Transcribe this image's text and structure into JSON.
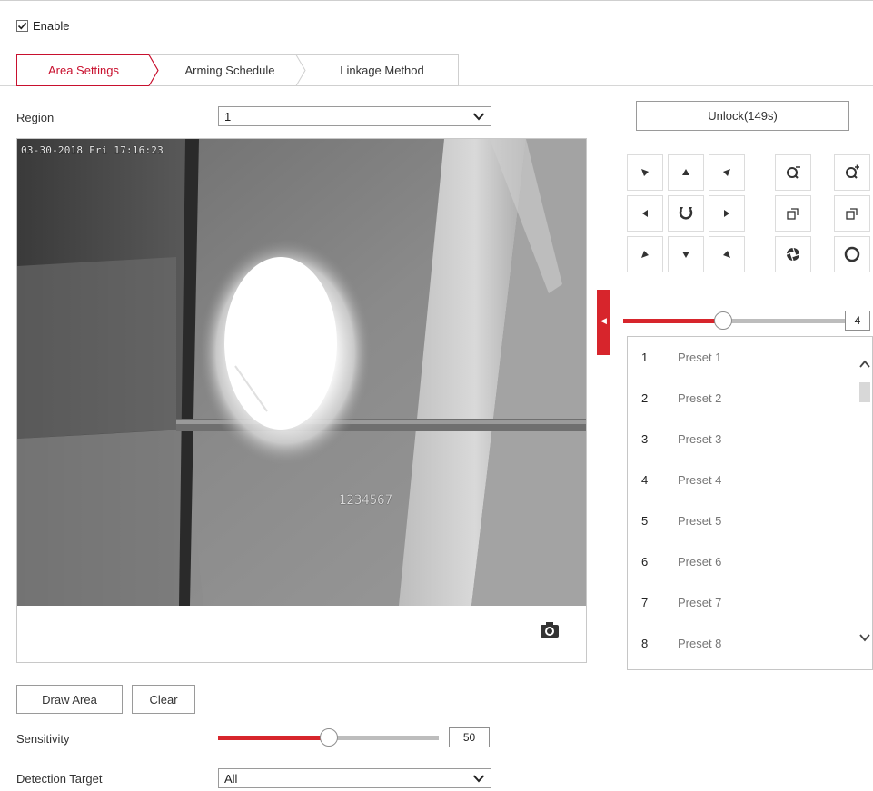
{
  "enable": {
    "label": "Enable",
    "checked": true
  },
  "tabs": [
    {
      "label": "Area Settings",
      "active": true
    },
    {
      "label": "Arming Schedule",
      "active": false
    },
    {
      "label": "Linkage Method",
      "active": false
    }
  ],
  "region": {
    "label": "Region",
    "value": "1"
  },
  "video": {
    "osd_time": "03-30-2018 Fri 17:16:23",
    "osd_id": "1234567"
  },
  "ptz": {
    "unlock_label": "Unlock(149s)",
    "speed_value": "4",
    "speed_level_fraction": 0.45,
    "accent_color": "#d7252c"
  },
  "presets": [
    {
      "num": "1",
      "name": "Preset 1"
    },
    {
      "num": "2",
      "name": "Preset 2"
    },
    {
      "num": "3",
      "name": "Preset 3"
    },
    {
      "num": "4",
      "name": "Preset 4"
    },
    {
      "num": "5",
      "name": "Preset 5"
    },
    {
      "num": "6",
      "name": "Preset 6"
    },
    {
      "num": "7",
      "name": "Preset 7"
    },
    {
      "num": "8",
      "name": "Preset 8"
    }
  ],
  "actions": {
    "draw_area": "Draw Area",
    "clear": "Clear"
  },
  "sensitivity": {
    "label": "Sensitivity",
    "value": "50",
    "level_fraction": 0.5
  },
  "detection_target": {
    "label": "Detection Target",
    "value": "All"
  }
}
